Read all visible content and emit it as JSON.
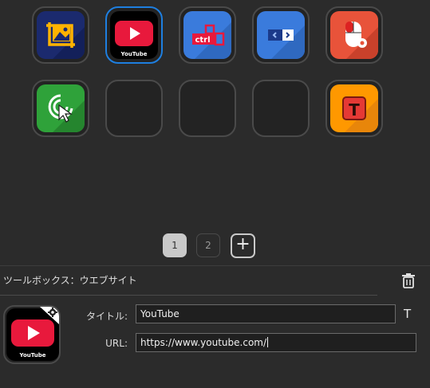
{
  "keys": [
    {
      "name": "image-crop-key",
      "icon": "image-crop-icon"
    },
    {
      "name": "youtube-key",
      "icon": "youtube-icon",
      "label": "YouTube",
      "selected": true
    },
    {
      "name": "ctrl-key",
      "icon": "ctrl-key-icon",
      "label": "ctrl"
    },
    {
      "name": "window-switch-key",
      "icon": "window-switch-icon"
    },
    {
      "name": "mouse-settings-key",
      "icon": "mouse-gear-icon"
    },
    {
      "name": "click-cursor-key",
      "icon": "click-cursor-icon"
    },
    {
      "name": "empty-key-1",
      "icon": ""
    },
    {
      "name": "empty-key-2",
      "icon": ""
    },
    {
      "name": "empty-key-3",
      "icon": ""
    },
    {
      "name": "text-key",
      "icon": "text-t-icon",
      "label": "T"
    }
  ],
  "pager": {
    "page1": "1",
    "page2": "2",
    "add": "+"
  },
  "panel": {
    "title": "ツールボックス：ウエブサイト",
    "preview_label": "YouTube",
    "title_label": "タイトル:",
    "title_value": "YouTube",
    "url_label": "URL:",
    "url_value": "https://www.youtube.com/",
    "text_tool": "T"
  },
  "colors": {
    "background": "#2b2b2b",
    "selected_border": "#1e7fe0",
    "youtube_red": "#e8193c",
    "blue_key": "#3a7bdc",
    "orange_key": "#ff9800",
    "green_key": "#2fa23a",
    "mouse_key": "#e8533a"
  }
}
